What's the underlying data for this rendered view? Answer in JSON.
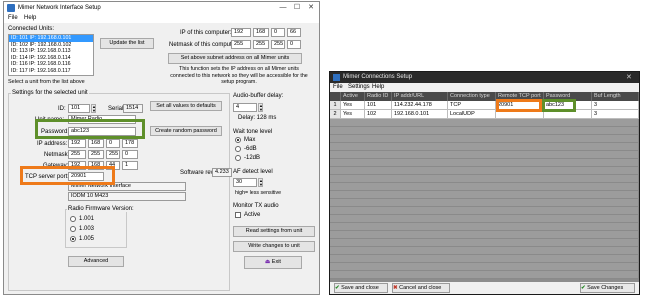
{
  "setup_window": {
    "title": "Mimer Network Interface Setup",
    "controls": {
      "minimize": "—",
      "maximize": "☐",
      "close": "✕"
    },
    "menu": [
      "File",
      "Help"
    ],
    "connected_units_label": "Connected Units:",
    "units": [
      "ID: 101  IP: 192.168.0.101",
      "ID: 102  IP: 192.168.0.102",
      "ID: 113  IP: 192.168.0.113",
      "ID: 114  IP: 192.168.0.114",
      "ID: 116  IP: 192.168.0.116",
      "ID: 117  IP: 192.168.0.117"
    ],
    "update_list_button": "Update the list",
    "select_unit_hint": "Select a unit from the list above",
    "ip_computer_label": "IP of this computer:",
    "ip_computer": [
      "192",
      "168",
      "0",
      "66"
    ],
    "netmask_computer_label": "Netmask of this computer:",
    "netmask_computer": [
      "255",
      "255",
      "255",
      "0"
    ],
    "set_subnet_button": "Set above subnet address on all Mimer units",
    "subnet_info": "This function sets the IP address on all Mimer units connected to this network so they will be accessible for the setup program.",
    "settings_group_label": "Settings for the selected unit",
    "id_label": "ID:",
    "id_value": "101",
    "serial_label": "Serial:",
    "serial_value": "1514",
    "set_defaults_button": "Set all values to defaults",
    "unit_name_label": "Unit name:",
    "unit_name_value": "Mimer Radio",
    "password_label": "Password:",
    "password_value": "abc123",
    "create_password_button": "Create random password",
    "ip_address_label": "IP address:",
    "ip_address": [
      "192",
      "168",
      "0",
      "178"
    ],
    "netmask_label": "Netmask:",
    "netmask": [
      "255",
      "255",
      "255",
      "0"
    ],
    "gateway_label": "Gateway:",
    "gateway": [
      "192",
      "168",
      "44",
      "1"
    ],
    "tcp_port_label": "TCP server port:",
    "tcp_port_value": "20901",
    "software_rev_label": "Software rev:",
    "software_rev_value": "4.233",
    "interface_name": "Mimer Network Interface",
    "interface_code": "IODM 10 M423",
    "firmware_label": "Radio Firmware Version:",
    "firmware_options": [
      "1.001",
      "1.003",
      "1.005"
    ],
    "firmware_selected_index": 2,
    "advanced_button": "Advanced",
    "audio_delay_label": "Audio-buffer delay:",
    "audio_delay_value": "4",
    "delay_text": "Delay: 128 ms",
    "wait_tone_label": "Wait tone level",
    "wait_tone_options": [
      "Max",
      "-6dB",
      "-12dB"
    ],
    "wait_tone_selected_index": 0,
    "af_detect_label": "AF detect level",
    "af_detect_value": "30",
    "af_detect_hint": "high=    less sensitive",
    "monitor_label": "Monitor TX audio",
    "monitor_active_label": "Active",
    "monitor_active": false,
    "read_settings_button": "Read settings from unit",
    "write_changes_button": "Write changes to unit",
    "exit_button": "Exit"
  },
  "connections_window": {
    "title": "Mimer Connections Setup",
    "menu": [
      "File",
      "Settings",
      "Help"
    ],
    "columns": [
      "",
      "Active",
      "Radio ID",
      "IP addr/URL",
      "Connection type",
      "Remote TCP port",
      "Password",
      "Buf Length"
    ],
    "rows": [
      [
        "1",
        "Yes",
        "101",
        "114.232.44.178",
        "TCP",
        "20901",
        "abc123",
        "3"
      ],
      [
        "2",
        "Yes",
        "102",
        "192.168.0.101",
        "LocalUDP",
        "",
        "",
        "3"
      ]
    ],
    "save_close_button": "Save and close",
    "cancel_close_button": "Cancel and close",
    "save_changes_button": "Save Changes"
  },
  "colors": {
    "highlight_green": "#5e8f2a",
    "highlight_orange": "#ee7a1a",
    "selection_blue": "#3399ff",
    "dark_window": "#3c3c3c"
  }
}
